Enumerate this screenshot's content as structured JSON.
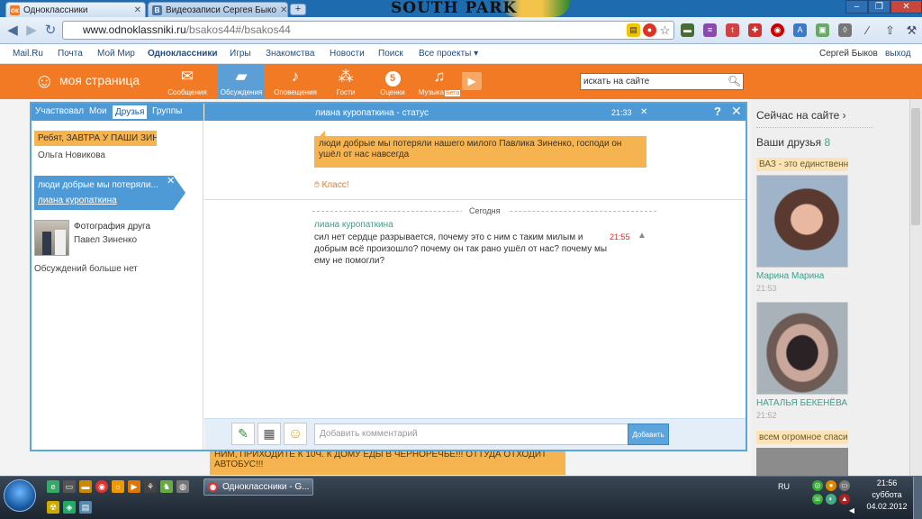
{
  "browser": {
    "tabs": [
      {
        "label": "Одноклассники",
        "favicon": "ok"
      },
      {
        "label": "Видеозаписи Сергея Быко",
        "favicon": "vk"
      }
    ],
    "banner_text": "SOUTH PARK",
    "url_host": "www.odnoklassniki.ru",
    "url_path": "/bsakos44#/bsakos44"
  },
  "portal": {
    "links": [
      "Mail.Ru",
      "Почта",
      "Мой Мир",
      "Одноклассники",
      "Игры",
      "Знакомства",
      "Новости",
      "Поиск",
      "Все проекты ▾"
    ],
    "user_name": "Сергей Быков",
    "logout": "выход"
  },
  "header": {
    "logo_text": "моя страница",
    "tools": [
      {
        "label": "Сообщения",
        "icon": "envelope-icon"
      },
      {
        "label": "Обсуждения",
        "icon": "chat-icon"
      },
      {
        "label": "Оповещения",
        "icon": "bell-icon"
      },
      {
        "label": "Гости",
        "icon": "footprints-icon"
      },
      {
        "label": "Оценки",
        "icon": "rating-icon"
      },
      {
        "label": "Музыка",
        "icon": "music-icon"
      }
    ],
    "ratings_badge": "5",
    "music_beta": "Бета",
    "search_placeholder": "искать на сайте"
  },
  "discussions": {
    "filter_tabs": [
      "Участвовал",
      "Мои",
      "Друзья",
      "Группы"
    ],
    "active_tab": "Друзья",
    "threads": [
      {
        "title": "Ребят, ЗАВТРА У ПАШИ ЗИНЕ",
        "author": "Ольга Новикова"
      },
      {
        "title": "люди добрые мы потеряли...",
        "author": "лиана куропаткина"
      },
      {
        "title": "Фотография друга",
        "author": "Павел Зиненко"
      }
    ],
    "no_more": "Обсуждений больше нет",
    "panel_title": "лиана куропаткина - статус",
    "panel_time": "21:33",
    "status_text": "люди добрые мы потеряли нашего милого Павлика Зиненко, господи он ушёл от нас навсегда",
    "klass_label": "Класс!",
    "date_separator": "Сегодня",
    "comment": {
      "author": "лиана куропаткина",
      "text": "сил нет сердце разрывается,  почему это с ним с таким милым и добрым всё произошло?  почему он так рано ушёл от нас?  почему мы ему не помогли?",
      "time": "21:55"
    },
    "comment_placeholder": "Добавить комментарий",
    "add_button": "Добавить"
  },
  "right_column": {
    "online_title": "Сейчас на сайте ›",
    "friends_title": "Ваши друзья",
    "friends_count": "8",
    "friends": [
      {
        "status": "ВАЗ - это единственн",
        "name": "Марина Марина",
        "time": "21:53"
      },
      {
        "status": "",
        "name": "НАТАЛЬЯ БЕКЕНЁВА",
        "time": "21:52"
      },
      {
        "status": "всем огромное спаси",
        "name": "",
        "time": ""
      }
    ]
  },
  "behind_text": "НИМ, ПРИХОДИТЕ К 10Ч. К ДОМУ ЕДЫ В ЧЕРНОРЕЧЬЕ!!! ОТТУДА ОТХОДИТ АВТОБУС!!!",
  "taskbar": {
    "active_window": "Одноклассники - G...",
    "lang": "RU",
    "time": "21:56",
    "day": "суббота",
    "date": "04.02.2012"
  },
  "colors": {
    "ok_orange": "#f37a24",
    "ok_blue": "#4e9ad6",
    "bubble_orange": "#f6b450",
    "name_green": "#3c9f8c"
  }
}
